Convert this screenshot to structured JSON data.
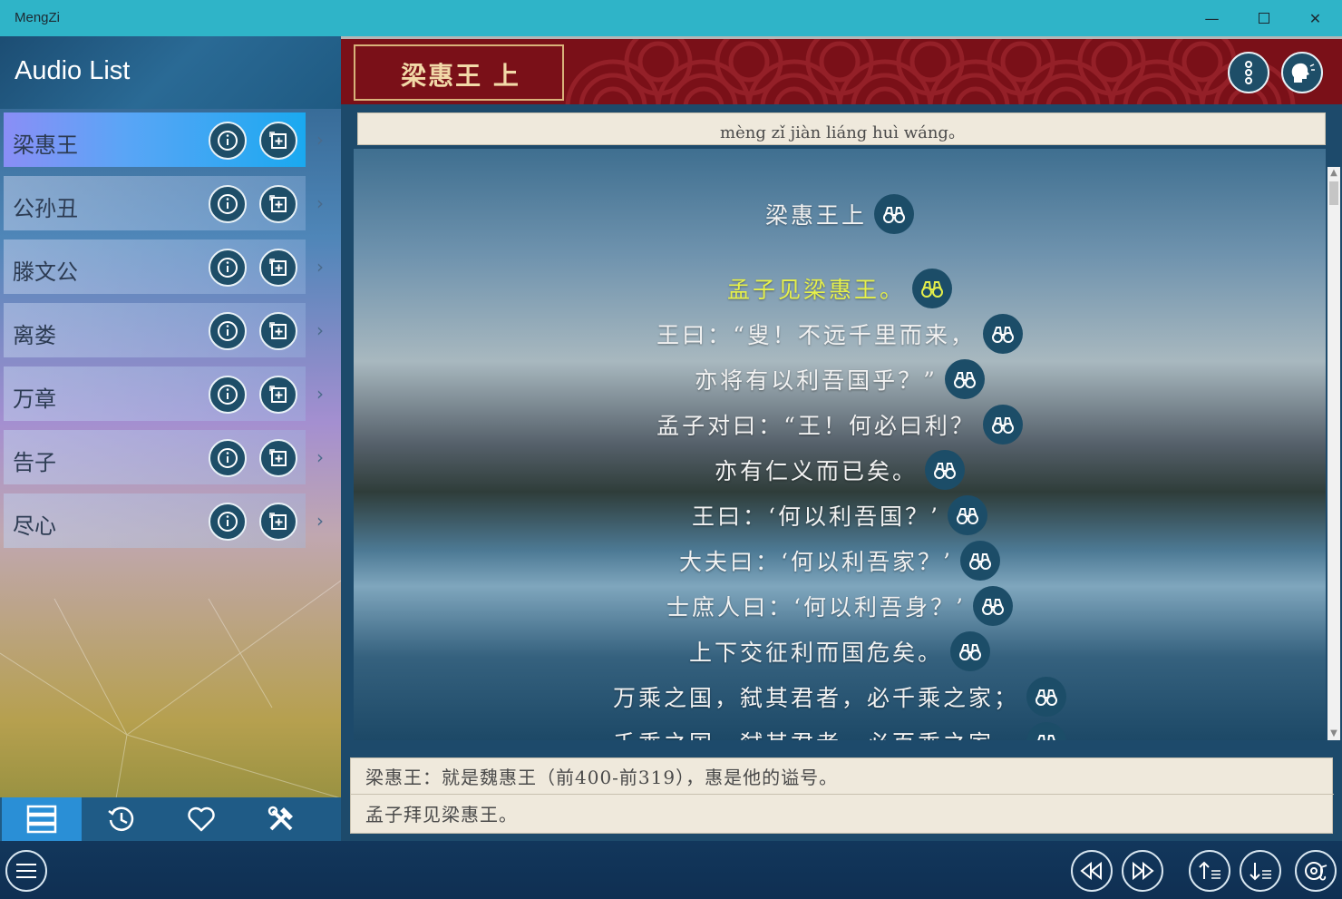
{
  "window": {
    "title": "MengZi",
    "minimize_icon": "minimize-icon",
    "maximize_icon": "maximize-icon",
    "close_icon": "close-icon"
  },
  "sidebar": {
    "title": "Audio List",
    "items": [
      {
        "label": "梁惠王",
        "selected": true
      },
      {
        "label": "公孙丑",
        "selected": false
      },
      {
        "label": "滕文公",
        "selected": false
      },
      {
        "label": "离娄",
        "selected": false
      },
      {
        "label": "万章",
        "selected": false
      },
      {
        "label": "告子",
        "selected": false
      },
      {
        "label": "尽心",
        "selected": false
      }
    ],
    "tabs": [
      {
        "icon": "list-icon",
        "active": true
      },
      {
        "icon": "history-icon",
        "active": false
      },
      {
        "icon": "heart-icon",
        "active": false
      },
      {
        "icon": "tools-icon",
        "active": false
      }
    ]
  },
  "header": {
    "chapter_title": "梁惠王 上",
    "menu_icon": "more-vertical-icon",
    "speak_icon": "speaking-head-icon"
  },
  "pinyin": "mèng zǐ jiàn liáng huì wáng。",
  "reader": {
    "lines": [
      {
        "text": "梁惠王上",
        "highlight": false
      },
      {
        "text": "孟子见梁惠王。",
        "highlight": true
      },
      {
        "text": "王曰：“叟！不远千里而来，",
        "highlight": false
      },
      {
        "text": "亦将有以利吾国乎？”",
        "highlight": false
      },
      {
        "text": "孟子对曰：“王！何必曰利？",
        "highlight": false
      },
      {
        "text": "亦有仁义而已矣。",
        "highlight": false
      },
      {
        "text": "王曰：‘何以利吾国？’",
        "highlight": false
      },
      {
        "text": "大夫曰：‘何以利吾家？’",
        "highlight": false
      },
      {
        "text": "士庶人曰：‘何以利吾身？’",
        "highlight": false
      },
      {
        "text": "上下交征利而国危矣。",
        "highlight": false
      },
      {
        "text": "万乘之国，弑其君者，必千乘之家；",
        "highlight": false
      },
      {
        "text": "千乘之国，弑其君者，必百乘之家。",
        "highlight": false
      }
    ]
  },
  "notes": {
    "annotation": "梁惠王：就是魏惠王（前400-前319），惠是他的谥号。",
    "translation": "孟子拜见梁惠王。"
  },
  "bottombar": {
    "menu_icon": "hamburger-icon",
    "buttons": [
      "rewind-icon",
      "fast-forward-icon",
      "sort-ascending-icon",
      "sort-descending-icon",
      "audio-settings-icon"
    ]
  },
  "colors": {
    "titlebar": "#2fb4c8",
    "header_red": "#7a1018",
    "highlight": "#e6f04a",
    "button_dark": "#1e4e68"
  }
}
